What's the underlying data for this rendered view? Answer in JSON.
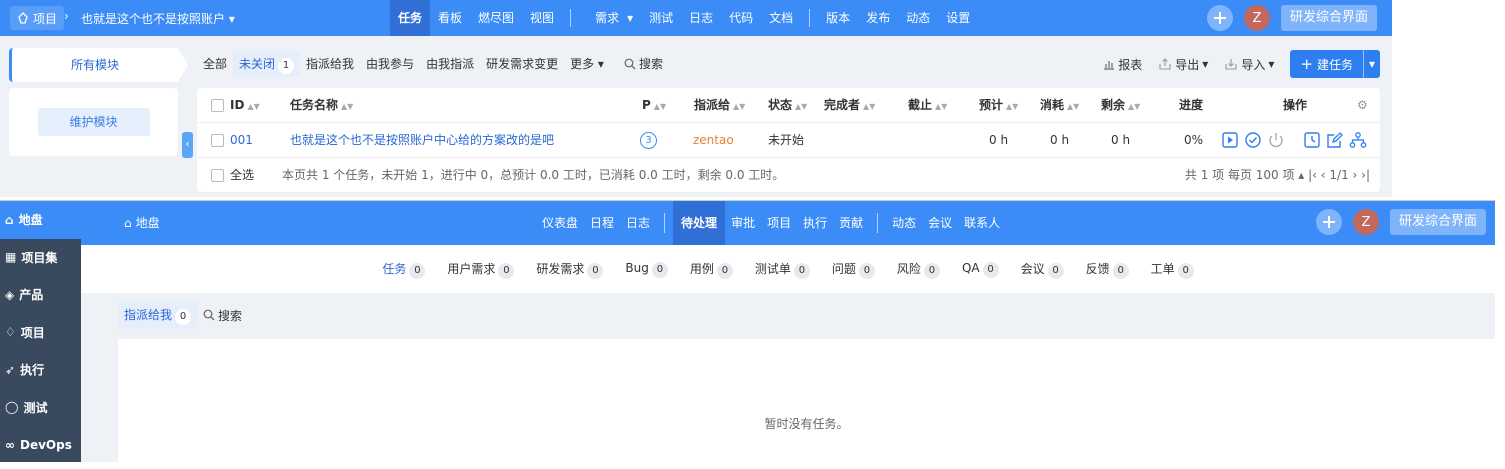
{
  "top": {
    "nav": {
      "project_label": "项目",
      "breadcrumb": "也就是这个也不是按照账户",
      "menu": [
        "任务",
        "看板",
        "燃尽图",
        "视图",
        "需求",
        "测试",
        "日志",
        "代码",
        "文档",
        "版本",
        "发布",
        "动态",
        "设置"
      ],
      "active": "任务",
      "avatar": "Z",
      "switch_label": "研发综合界面"
    },
    "sidebar": {
      "title": "所有模块",
      "maintain": "维护模块"
    },
    "filters": [
      {
        "label": "全部"
      },
      {
        "label": "未关闭",
        "count": "1",
        "active": true
      },
      {
        "label": "指派给我"
      },
      {
        "label": "由我参与"
      },
      {
        "label": "由我指派"
      },
      {
        "label": "研发需求变更"
      },
      {
        "label": "更多"
      }
    ],
    "search_label": "搜索",
    "tools": {
      "report": "报表",
      "export": "导出",
      "import": "导入",
      "create": "建任务"
    },
    "table": {
      "headers": {
        "id": "ID",
        "name": "任务名称",
        "pri": "P",
        "assigned": "指派给",
        "status": "状态",
        "finished_by": "完成者",
        "deadline": "截止",
        "estimate": "预计",
        "consumed": "消耗",
        "left": "剩余",
        "progress": "进度",
        "actions": "操作"
      },
      "rows": [
        {
          "id": "001",
          "name": "也就是这个也不是按照账户中心给的方案改的是吧",
          "pri": "3",
          "assigned": "zentao",
          "status": "未开始",
          "finished_by": "",
          "deadline": "",
          "estimate": "0 h",
          "consumed": "0 h",
          "left": "0 h",
          "progress": "0%"
        }
      ],
      "footer": {
        "select_all": "全选",
        "summary": "本页共 1 个任务，未开始 1，进行中 0，总预计 0.0 工时，已消耗 0.0 工时，剩余 0.0 工时。",
        "pager": "共 1 项  每页 100 项 ▴  |‹  ‹  1/1  ›  ›|"
      }
    },
    "colors": {
      "brand": "#3b8cf7",
      "assigned": "#e0873a"
    }
  },
  "bottom": {
    "sidebar": [
      {
        "label": "地盘",
        "icon": "home-icon",
        "active": true
      },
      {
        "label": "项目集",
        "icon": "grid-icon"
      },
      {
        "label": "产品",
        "icon": "product-icon"
      },
      {
        "label": "项目",
        "icon": "project-icon"
      },
      {
        "label": "执行",
        "icon": "run-icon"
      },
      {
        "label": "测试",
        "icon": "test-icon"
      },
      {
        "label": "DevOps",
        "icon": "infinity-icon"
      }
    ],
    "nav": {
      "home": "地盘",
      "menu": [
        "仪表盘",
        "日程",
        "日志",
        "待处理",
        "审批",
        "项目",
        "执行",
        "贡献",
        "动态",
        "会议",
        "联系人"
      ],
      "active": "待处理",
      "avatar": "Z",
      "switch_label": "研发综合界面"
    },
    "tabs": [
      {
        "label": "任务",
        "count": "0",
        "active": true
      },
      {
        "label": "用户需求",
        "count": "0"
      },
      {
        "label": "研发需求",
        "count": "0"
      },
      {
        "label": "Bug",
        "count": "0"
      },
      {
        "label": "用例",
        "count": "0"
      },
      {
        "label": "测试单",
        "count": "0"
      },
      {
        "label": "问题",
        "count": "0"
      },
      {
        "label": "风险",
        "count": "0"
      },
      {
        "label": "QA",
        "count": "0"
      },
      {
        "label": "会议",
        "count": "0"
      },
      {
        "label": "反馈",
        "count": "0"
      },
      {
        "label": "工单",
        "count": "0"
      }
    ],
    "sub": {
      "assigned": "指派给我",
      "count": "0",
      "search": "搜索"
    },
    "empty": "暂时没有任务。"
  }
}
